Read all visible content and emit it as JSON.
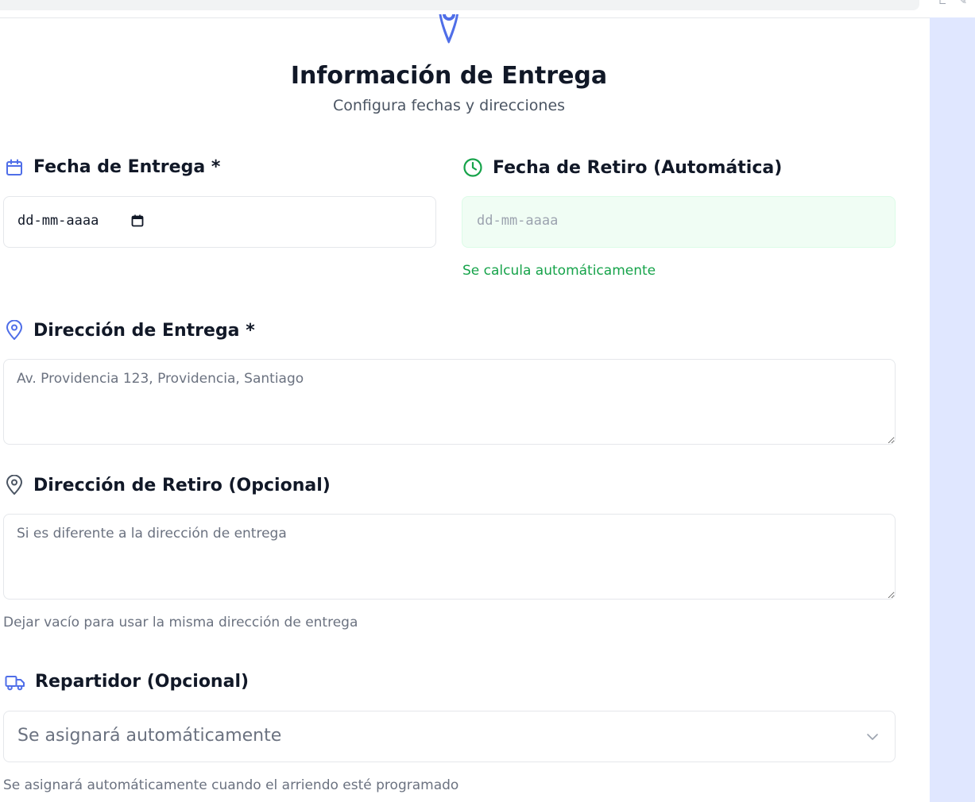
{
  "header": {
    "icon": "map-pin-icon",
    "title": "Información de Entrega",
    "subtitle": "Configura fechas y direcciones"
  },
  "delivery_date": {
    "icon": "calendar-icon",
    "label": "Fecha de Entrega *",
    "value": "dd-mm-aaaa"
  },
  "pickup_date": {
    "icon": "clock-icon",
    "label": "Fecha de Retiro (Automática)",
    "value": "dd-mm-aaaa",
    "helper": "Se calcula automáticamente"
  },
  "delivery_address": {
    "icon": "map-pin-icon",
    "label": "Dirección de Entrega *",
    "placeholder": "Av. Providencia 123, Providencia, Santiago"
  },
  "pickup_address": {
    "icon": "map-pin-icon",
    "label": "Dirección de Retiro (Opcional)",
    "placeholder": "Si es diferente a la dirección de entrega",
    "helper": "Dejar vacío para usar la misma dirección de entrega"
  },
  "driver": {
    "icon": "truck-icon",
    "label": "Repartidor (Opcional)",
    "selected": "Se asignará automáticamente",
    "helper": "Se asignará automáticamente cuando el arriendo esté programado"
  },
  "colors": {
    "accent_blue": "#4f6ee8",
    "accent_green": "#16a34a",
    "side_panel": "#e0e7ff"
  }
}
